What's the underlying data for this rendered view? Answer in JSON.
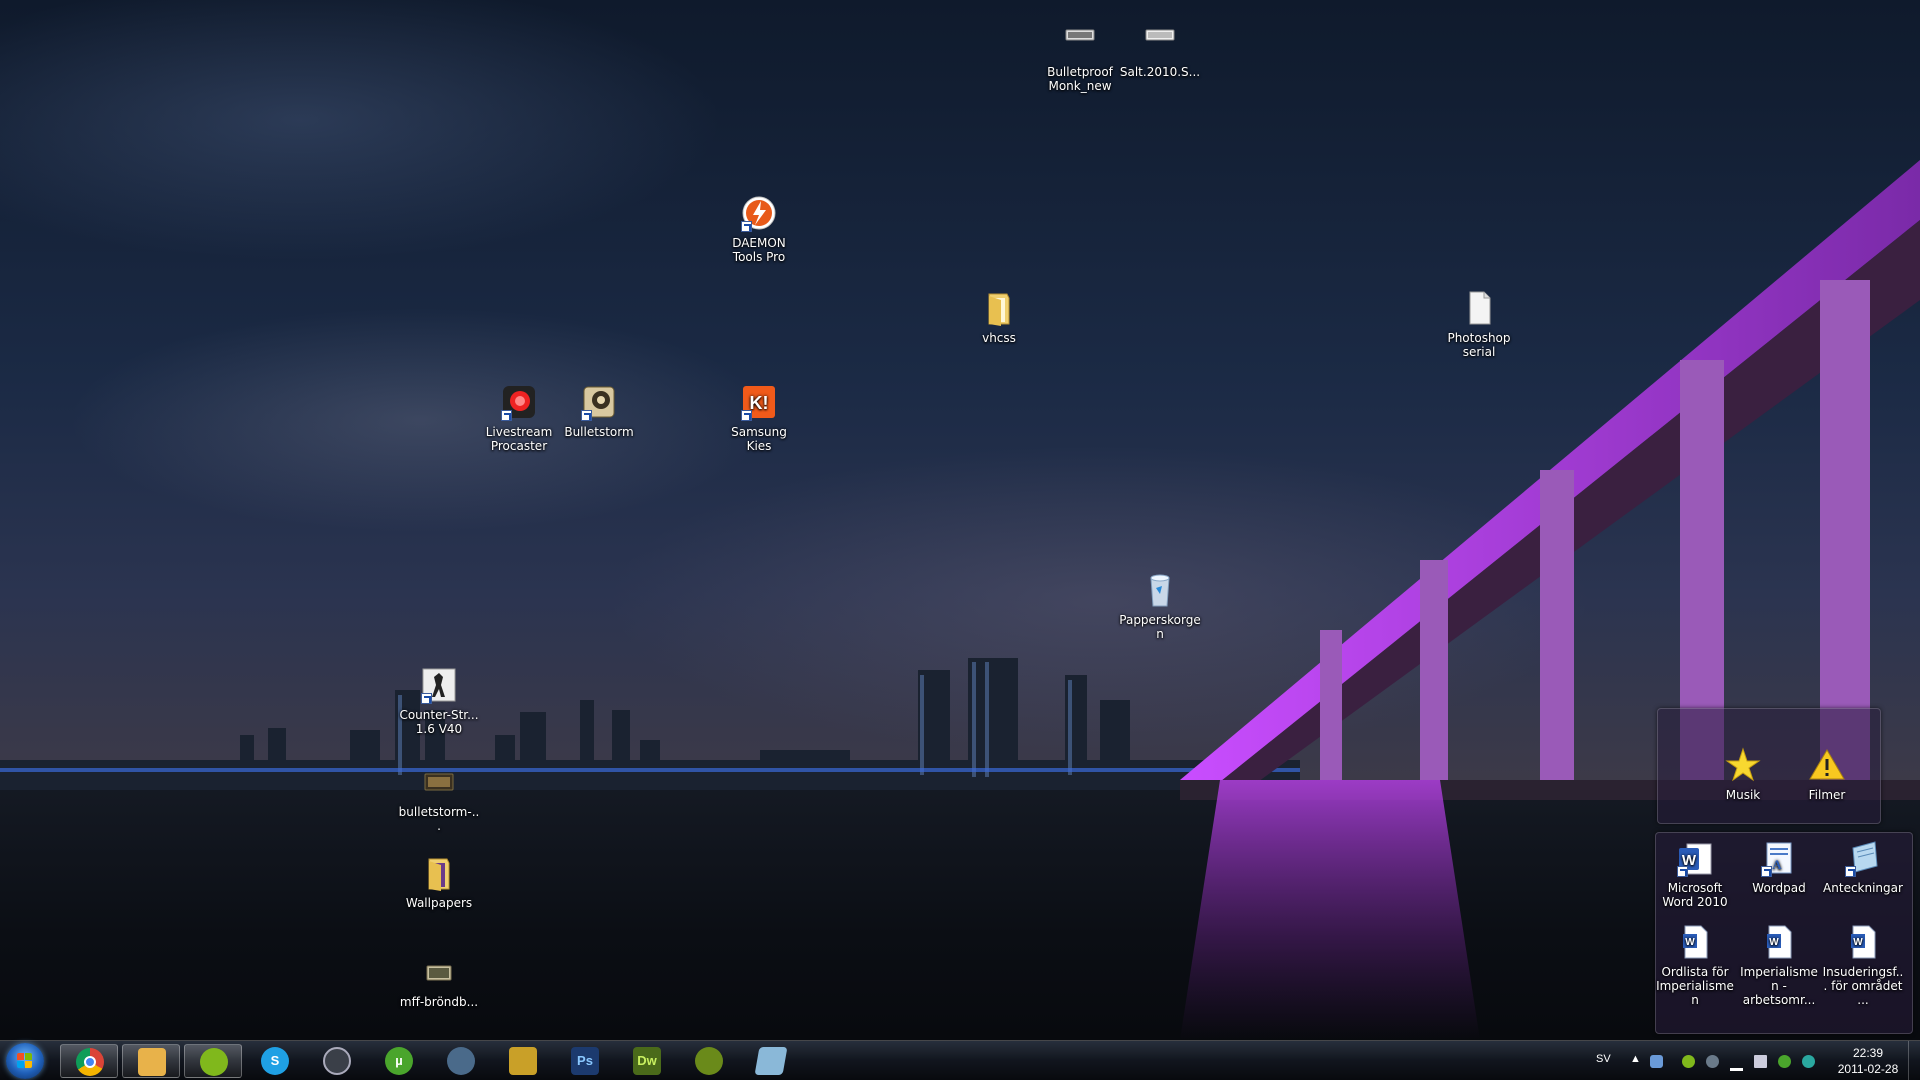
{
  "desktop": {
    "icons": [
      {
        "id": "bulletproof",
        "label": "Bulletproof Monk_new",
        "icon": "video-file-icon"
      },
      {
        "id": "salt",
        "label": "Salt.2010.S...",
        "icon": "video-file-icon"
      },
      {
        "id": "daemon",
        "label": "DAEMON Tools Pro",
        "icon": "daemon-tools-icon"
      },
      {
        "id": "vhcss",
        "label": "vhcss",
        "icon": "folder-icon"
      },
      {
        "id": "photoshop-serial",
        "label": "Photoshop serial",
        "icon": "text-file-icon"
      },
      {
        "id": "livestream",
        "label": "Livestream Procaster",
        "icon": "livestream-icon"
      },
      {
        "id": "bulletstorm",
        "label": "Bulletstorm",
        "icon": "bulletstorm-icon"
      },
      {
        "id": "samsung-kies",
        "label": "Samsung Kies",
        "icon": "samsung-kies-icon"
      },
      {
        "id": "recycle",
        "label": "Papperskorgen",
        "icon": "recycle-bin-icon"
      },
      {
        "id": "counter-strike",
        "label": "Counter-Str... 1.6 V40",
        "icon": "counter-strike-icon"
      },
      {
        "id": "bulletstorm-file",
        "label": "bulletstorm-...",
        "icon": "video-file-icon"
      },
      {
        "id": "wallpapers",
        "label": "Wallpapers",
        "icon": "folder-icon"
      },
      {
        "id": "mff",
        "label": "mff-bröndb...",
        "icon": "video-file-icon"
      }
    ]
  },
  "gadget_top": {
    "items": [
      {
        "id": "musik",
        "label": "Musik",
        "icon": "star-icon"
      },
      {
        "id": "filmer",
        "label": "Filmer",
        "icon": "warning-icon"
      }
    ]
  },
  "gadget_bottom": {
    "items": [
      {
        "id": "word",
        "label": "Microsoft Word 2010",
        "icon": "word-icon"
      },
      {
        "id": "wordpad",
        "label": "Wordpad",
        "icon": "wordpad-icon"
      },
      {
        "id": "anteckningar",
        "label": "Anteckningar",
        "icon": "notepad-icon"
      },
      {
        "id": "ordlista",
        "label": "Ordlista för Imperialismen",
        "icon": "word-doc-icon"
      },
      {
        "id": "imperialismen",
        "label": "Imperialismen - arbetsomr...",
        "icon": "word-doc-icon"
      },
      {
        "id": "insuderings",
        "label": "Insuderingsf... för området ...",
        "icon": "word-doc-icon"
      }
    ]
  },
  "taskbar": {
    "apps": [
      {
        "id": "chrome",
        "icon": "chrome-icon",
        "text": "",
        "active": true,
        "color": "#d9403a"
      },
      {
        "id": "explorer",
        "icon": "windows-explorer-icon",
        "text": "",
        "active": true,
        "color": "#e8b24a"
      },
      {
        "id": "spotify",
        "icon": "spotify-icon",
        "text": "",
        "active": true,
        "color": "#80b81c"
      },
      {
        "id": "skype",
        "icon": "skype-icon",
        "text": "S",
        "active": false,
        "color": "#1fa0e4"
      },
      {
        "id": "steam",
        "icon": "steam-icon",
        "text": "",
        "active": false,
        "color": "#3a3f48"
      },
      {
        "id": "utorrent",
        "icon": "utorrent-icon",
        "text": "µ",
        "active": false,
        "color": "#4aa52c"
      },
      {
        "id": "game",
        "icon": "gamepad-icon",
        "text": "",
        "active": false,
        "color": "#4a6a8a"
      },
      {
        "id": "winamp",
        "icon": "media-player-icon",
        "text": "",
        "active": false,
        "color": "#c9a028"
      },
      {
        "id": "photoshop",
        "icon": "photoshop-icon",
        "text": "Ps",
        "active": false,
        "color": "#1c3a6e"
      },
      {
        "id": "dreamweaver",
        "icon": "dreamweaver-icon",
        "text": "Dw",
        "active": false,
        "color": "#4a6a1a"
      },
      {
        "id": "cinema4d",
        "icon": "lightbulb-icon",
        "text": "",
        "active": false,
        "color": "#6a8a1a"
      },
      {
        "id": "notes",
        "icon": "notepad-icon",
        "text": "",
        "active": false,
        "color": "#8ab8d8"
      }
    ],
    "tray": {
      "language": "SV",
      "time": "22:39",
      "date": "2011-02-28"
    }
  }
}
